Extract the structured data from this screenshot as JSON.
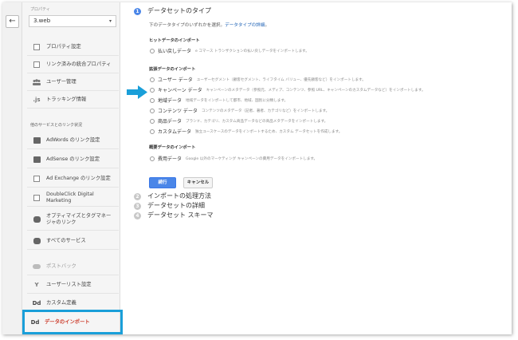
{
  "sidebar": {
    "back_icon": "←",
    "property_label": "プロパティ",
    "property_value": "3.web",
    "property_caret": "▾",
    "items_top": [
      {
        "label": "プロパティ設定",
        "icon": "settings-box-icon"
      },
      {
        "label": "リンク済みの統合プロパティ",
        "icon": "linked-property-icon"
      },
      {
        "label": "ユーザー管理",
        "icon": "users-icon"
      },
      {
        "label": "トラッキング情報",
        "icon": "tracking-code-icon"
      }
    ],
    "section_label": "他のサービスとのリンク状況",
    "items_links": [
      {
        "label": "AdWords のリンク設定",
        "icon": "adwords-icon"
      },
      {
        "label": "AdSense のリンク設定",
        "icon": "adsense-icon"
      },
      {
        "label": "Ad Exchange のリンク設定",
        "icon": "ad-exchange-icon"
      },
      {
        "label": "DoubleClick Digital Marketing",
        "icon": "doubleclick-icon"
      },
      {
        "label": "オプティマイズとタグマネー\nジャのリンク",
        "icon": "optimize-link-icon"
      },
      {
        "label": "すべてのサービス",
        "icon": "all-services-icon"
      }
    ],
    "items_bottom": [
      {
        "label": "ポストバック",
        "icon": "postback-icon"
      },
      {
        "label": "ユーザーリスト設定",
        "icon": "user-list-icon"
      },
      {
        "label": "カスタム定義",
        "icon": "dd-icon",
        "glyph": "Dd"
      },
      {
        "label": "データのインポート",
        "icon": "dd-icon",
        "glyph": "Dd"
      }
    ]
  },
  "main": {
    "steps": [
      {
        "num": "1",
        "title": "データセットのタイプ"
      },
      {
        "num": "2",
        "title": "インポートの処理方法"
      },
      {
        "num": "3",
        "title": "データセットの詳細"
      },
      {
        "num": "4",
        "title": "データセット スキーマ"
      }
    ],
    "description": "下のデータタイプのいずれかを選択。",
    "description_link": "データタイプの詳細",
    "description_end": "。",
    "sections": {
      "hit": "ヒットデータのインポート",
      "extended": "拡張データのインポート",
      "summary": "概要データのインポート"
    },
    "options_hit": [
      {
        "label": "払い戻しデータ",
        "desc": "e コマース トランザクションの払い戻しデータをインポートします。"
      }
    ],
    "options_extended": [
      {
        "label": "ユーザー データ",
        "desc": "ユーザーセグメント（顧客セグメント、ライフタイム バリュー、優先顧客など）をインポートします。"
      },
      {
        "label": "キャンペーン データ",
        "desc": "キャンペーンのメタデータ（参照元、メディア、コンテンツ、参照 URL、キャンペーンのカスタムデータなど）をインポートします。"
      },
      {
        "label": "地域データ",
        "desc": "地域データをインポートして都市、地域、国別に分類します。"
      },
      {
        "label": "コンテンツ データ",
        "desc": "コンテンツのメタデータ（記者、著者、カテゴリなど）をインポートします。"
      },
      {
        "label": "商品データ",
        "desc": "ブランド、カテゴリ、カスタム商品データなどの商品メタデータをインポートします。"
      },
      {
        "label": "カスタムデータ",
        "desc": "独立ユースケースのデータをインポートするため、カスタム データセットを作成します。"
      }
    ],
    "options_summary": [
      {
        "label": "費用データ",
        "desc": "Google 以外のマーケティング キャンペーンの費用データをインポートします。"
      }
    ],
    "apply_label": "続行",
    "cancel_label": "キャンセル"
  },
  "colors": {
    "accent": "#4a86e8",
    "highlight_border": "#1a9fd9",
    "arrow": "#1a9fd9",
    "active_text": "#cc3b2a"
  }
}
